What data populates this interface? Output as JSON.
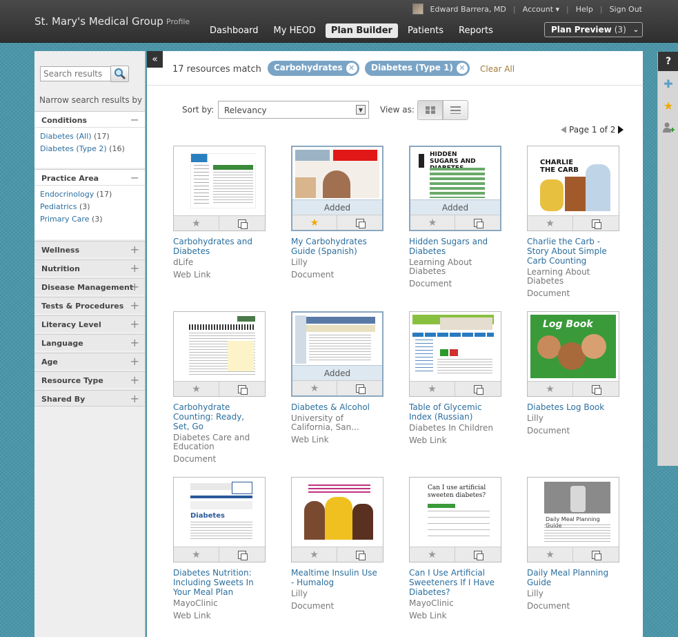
{
  "topbar": {
    "brand": "St. Mary's Medical Group",
    "profile": "Profile",
    "user_name": "Edward Barrera, MD",
    "account": "Account ▾",
    "help": "Help",
    "sign_out": "Sign Out",
    "nav": [
      "Dashboard",
      "My HEOD",
      "Plan Builder",
      "Patients",
      "Reports"
    ],
    "active_nav": "Plan Builder",
    "plan_preview": "Plan Preview",
    "plan_preview_count": "(3)"
  },
  "sidebar": {
    "search_placeholder": "Search results",
    "narrow_label": "Narrow search results by",
    "facets": [
      {
        "label": "Conditions",
        "open": true,
        "items": [
          {
            "name": "Diabetes (All)",
            "count": "(17)"
          },
          {
            "name": "Diabetes (Type 2)",
            "count": "(16)"
          }
        ]
      },
      {
        "label": "Practice Area",
        "open": true,
        "items": [
          {
            "name": "Endocrinology",
            "count": "(17)"
          },
          {
            "name": "Pediatrics",
            "count": "(3)"
          },
          {
            "name": "Primary Care",
            "count": "(3)"
          }
        ]
      },
      {
        "label": "Wellness"
      },
      {
        "label": "Nutrition"
      },
      {
        "label": "Disease Management"
      },
      {
        "label": "Tests & Procedures"
      },
      {
        "label": "Literacy Level"
      },
      {
        "label": "Language"
      },
      {
        "label": "Age"
      },
      {
        "label": "Resource Type"
      },
      {
        "label": "Shared By"
      }
    ]
  },
  "results": {
    "match_text": "17 resources match",
    "chips": [
      "Carbohydrates",
      "Diabetes (Type 1)"
    ],
    "clear_all": "Clear All",
    "sort_label": "Sort by:",
    "sort_value": "Relevancy",
    "view_label": "View as:",
    "page_text": "Page 1 of 2"
  },
  "cards": [
    {
      "title": "Carbohydrates and Diabetes",
      "source": "dLife",
      "type": "Web Link",
      "added": false,
      "starred": false
    },
    {
      "title": "My Carbohydrates Guide (Spanish)",
      "source": "Lilly",
      "type": "Document",
      "added": true,
      "starred": true
    },
    {
      "title": "Hidden Sugars and Diabetes",
      "source": "Learning About Diabetes",
      "type": "Document",
      "added": true,
      "starred": false
    },
    {
      "title": "Charlie the Carb - Story About Simple Carb Counting",
      "source": "Learning About Diabetes",
      "type": "Document",
      "added": false,
      "starred": false
    },
    {
      "title": "Carbohydrate Counting: Ready, Set, Go",
      "source": "Diabetes Care and Education",
      "type": "Document",
      "added": false,
      "starred": false
    },
    {
      "title": "Diabetes & Alcohol",
      "source": "University of California, San...",
      "type": "Web Link",
      "added": true,
      "starred": false
    },
    {
      "title": "Table of Glycemic Index (Russian)",
      "source": "Diabetes In Children",
      "type": "Web Link",
      "added": false,
      "starred": false
    },
    {
      "title": "Diabetes Log Book",
      "source": "Lilly",
      "type": "Document",
      "added": false,
      "starred": false
    },
    {
      "title": "Diabetes Nutrition: Including Sweets In Your Meal Plan",
      "source": "MayoClinic",
      "type": "Web Link",
      "added": false,
      "starred": false
    },
    {
      "title": "Mealtime Insulin Use - Humalog",
      "source": "Lilly",
      "type": "Document",
      "added": false,
      "starred": false
    },
    {
      "title": "Can I Use Artificial Sweeteners If I Have Diabetes?",
      "source": "MayoClinic",
      "type": "Web Link",
      "added": false,
      "starred": false
    },
    {
      "title": "Daily Meal Planning Guide",
      "source": "Lilly",
      "type": "Document",
      "added": false,
      "starred": false
    }
  ],
  "thumb_text": {
    "hidden_sugars": "HIDDEN SUGARS AND DIABETES",
    "charlie": "CHARLIE THE CARB",
    "log_book": "Log Book",
    "can_i_use": "Can I use artificial sweeten diabetes?",
    "daily_meal": "Daily Meal Planning Guide",
    "diabetes_heading": "Diabetes",
    "added_label": "Added"
  },
  "rail": {
    "help": "?"
  }
}
